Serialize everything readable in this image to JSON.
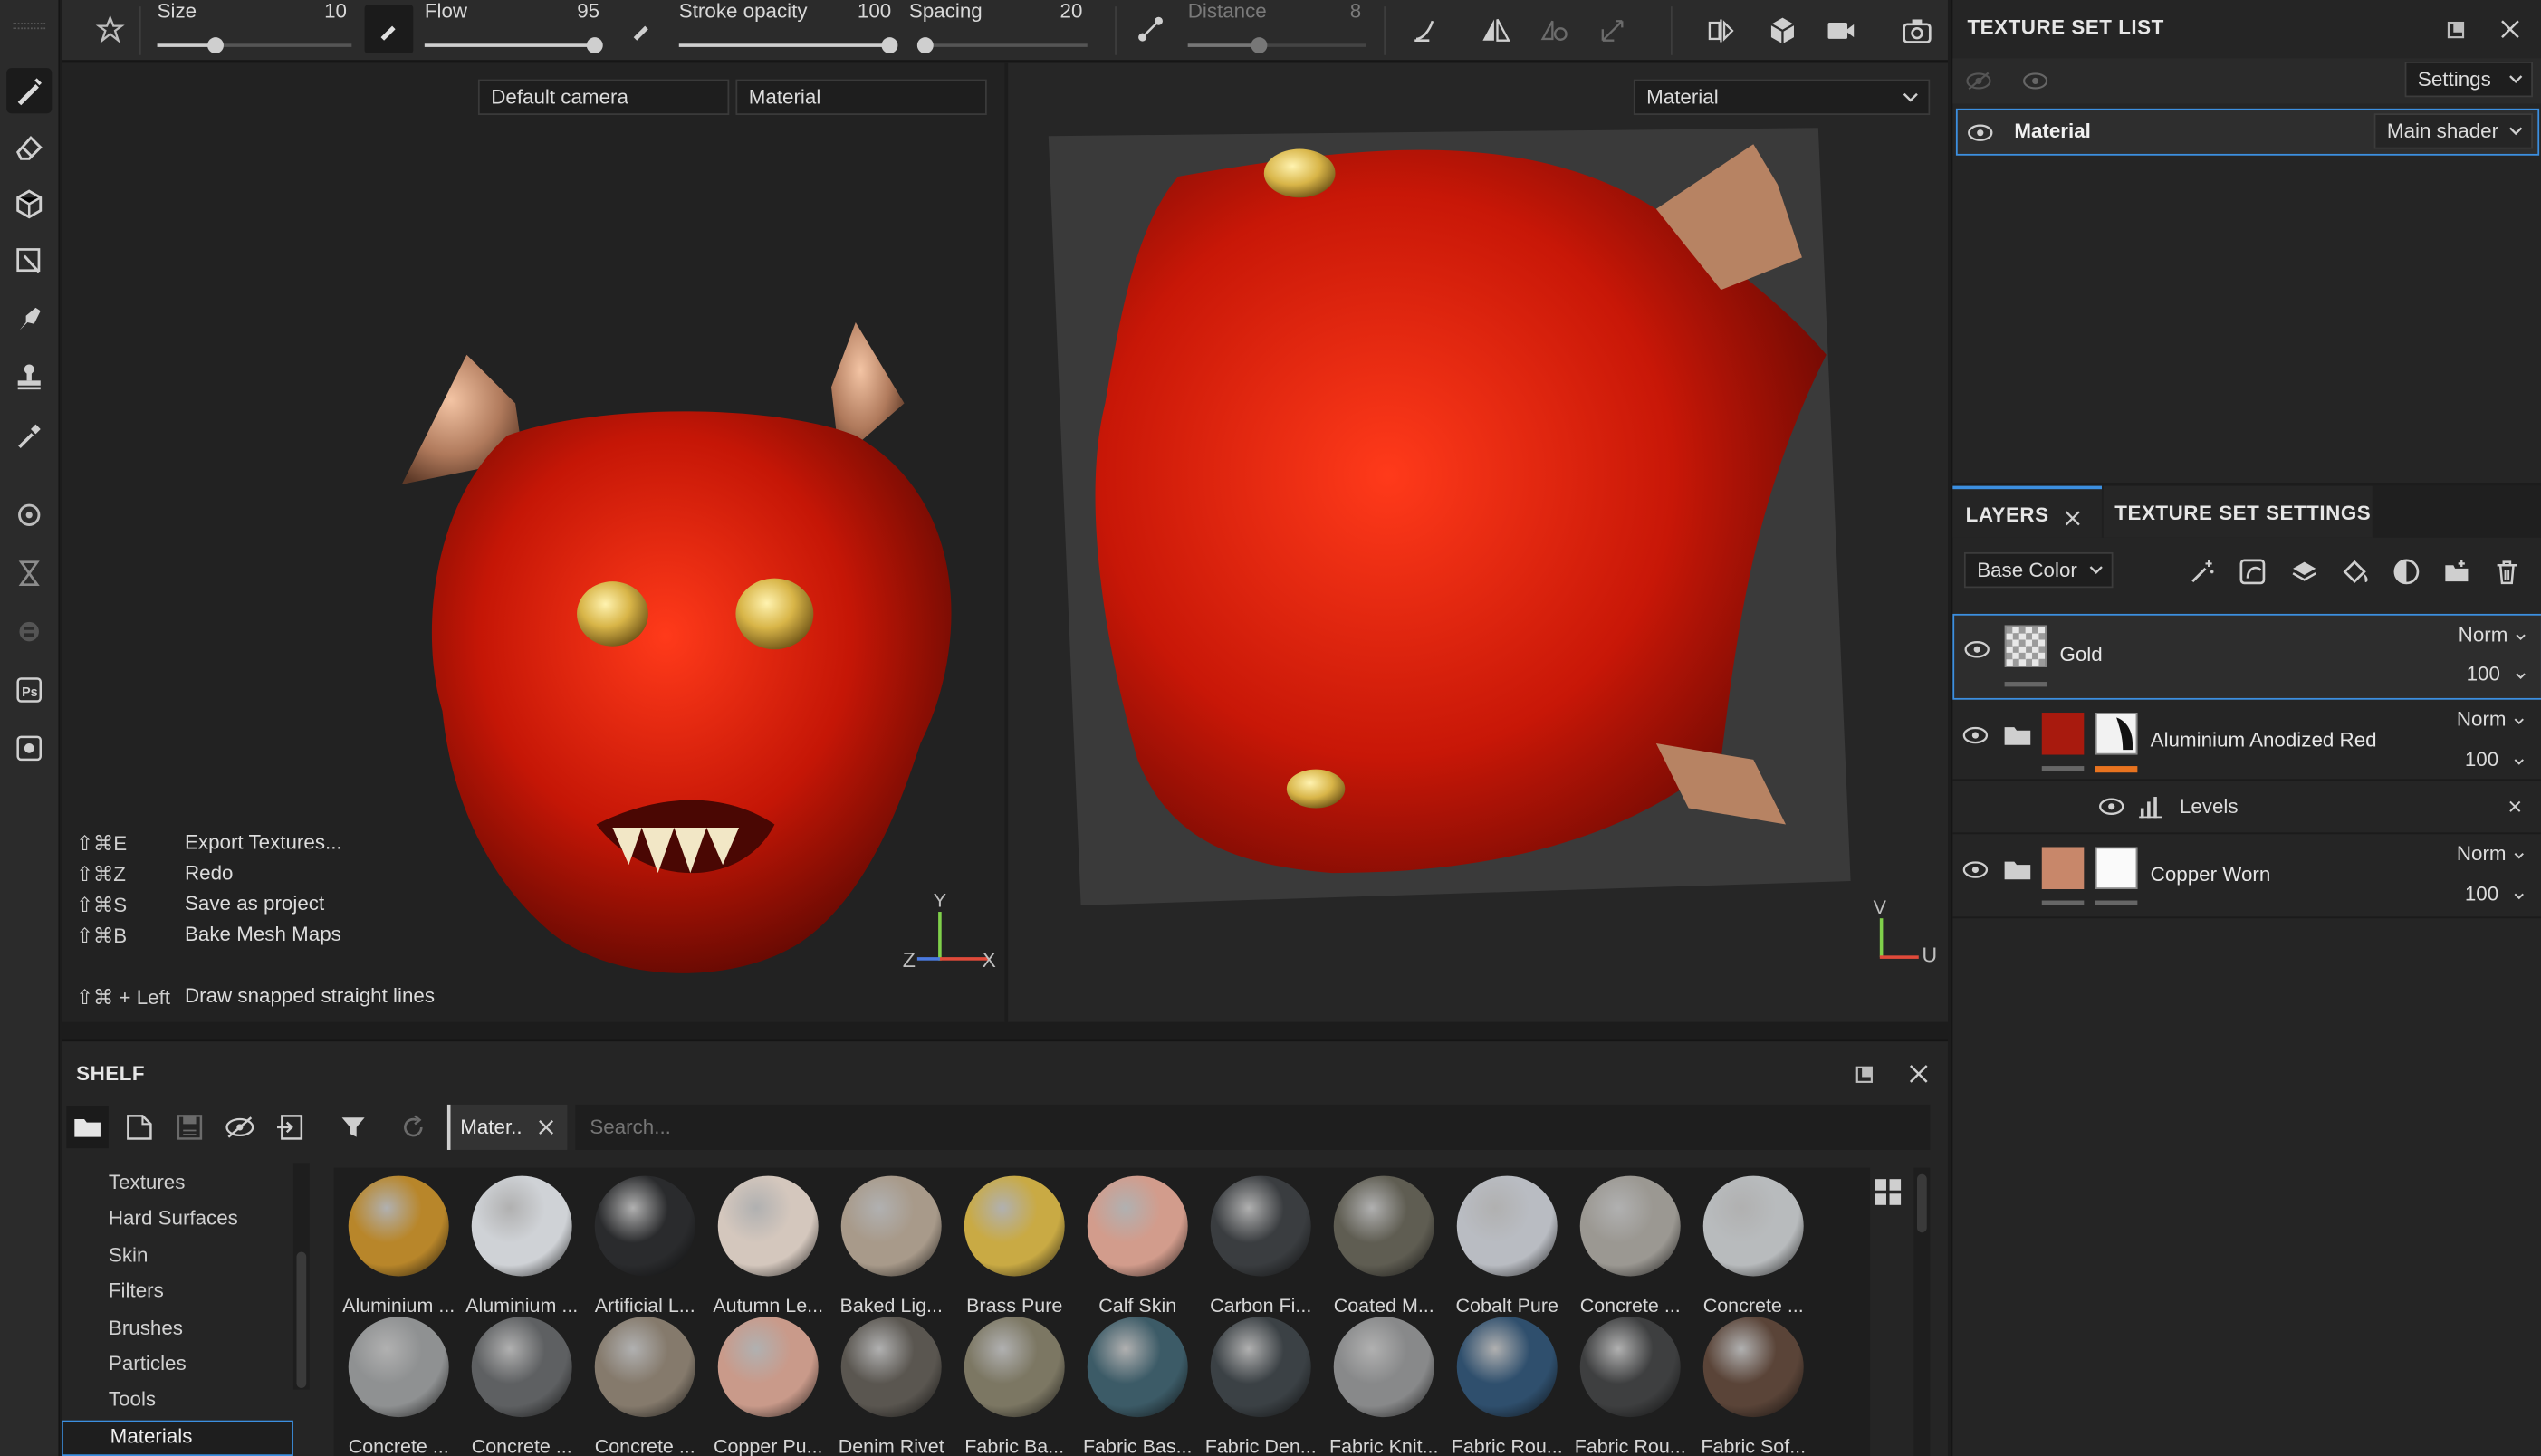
{
  "toolbar": {
    "size": {
      "label": "Size",
      "value": "10",
      "fraction": 0.3
    },
    "flow": {
      "label": "Flow",
      "value": "95",
      "fraction": 0.95
    },
    "stroke_opacity": {
      "label": "Stroke opacity",
      "value": "100",
      "fraction": 1.0
    },
    "spacing": {
      "label": "Spacing",
      "value": "20",
      "fraction": 0.0
    },
    "distance": {
      "label": "Distance",
      "value": "8",
      "fraction": 0.4
    }
  },
  "viewport3d": {
    "camera": "Default camera",
    "channel": "Material",
    "shortcuts": [
      {
        "key": "⇧⌘E",
        "label": "Export Textures..."
      },
      {
        "key": "⇧⌘Z",
        "label": "Redo"
      },
      {
        "key": "⇧⌘S",
        "label": "Save as project"
      },
      {
        "key": "⇧⌘B",
        "label": "Bake Mesh Maps"
      }
    ],
    "hint_key": "⇧⌘ + Left",
    "hint_label": "Draw snapped straight lines",
    "axes": {
      "y": "Y",
      "z": "Z",
      "x": "X"
    }
  },
  "viewport2d": {
    "channel": "Material",
    "axes": {
      "v": "V",
      "u": "U"
    }
  },
  "texture_set_list": {
    "title": "TEXTURE SET LIST",
    "settings_label": "Settings",
    "item_name": "Material",
    "shader": "Main shader"
  },
  "layers_panel": {
    "tab_layers": "LAYERS",
    "tab_settings": "TEXTURE SET SETTINGS",
    "channel": "Base Color",
    "layers": [
      {
        "name": "Gold",
        "blend": "Norm",
        "opacity": "100"
      },
      {
        "name": "Aluminium Anodized Red",
        "blend": "Norm",
        "opacity": "100",
        "color": "#a81a0e"
      },
      {
        "name": "Copper Worn",
        "blend": "Norm",
        "opacity": "100",
        "color": "#c8876a"
      }
    ],
    "effect_name": "Levels"
  },
  "shelf": {
    "title": "SHELF",
    "filter_tag": "Mater..",
    "search_placeholder": "Search...",
    "categories": [
      "Textures",
      "Hard Surfaces",
      "Skin",
      "Filters",
      "Brushes",
      "Particles",
      "Tools",
      "Materials"
    ],
    "selected_category": "Materials",
    "materials": [
      {
        "name": "Aluminium ...",
        "color": "#b8862a"
      },
      {
        "name": "Aluminium ...",
        "color": "#cfd2d6"
      },
      {
        "name": "Artificial L...",
        "color": "#2a2b2d"
      },
      {
        "name": "Autumn Le...",
        "color": "#d4c7bd"
      },
      {
        "name": "Baked Lig...",
        "color": "#a89a8a"
      },
      {
        "name": "Brass Pure",
        "color": "#c9aa44"
      },
      {
        "name": "Calf Skin",
        "color": "#d29c8c"
      },
      {
        "name": "Carbon Fi...",
        "color": "#3a3d40"
      },
      {
        "name": "Coated M...",
        "color": "#5f5d52"
      },
      {
        "name": "Cobalt Pure",
        "color": "#b9bcc2"
      },
      {
        "name": "Concrete ...",
        "color": "#9b9892"
      },
      {
        "name": "Concrete ...",
        "color": "#b8bbbd"
      },
      {
        "name": "Concrete ...",
        "color": "#8f9192"
      },
      {
        "name": "Concrete ...",
        "color": "#5e6062"
      },
      {
        "name": "Concrete ...",
        "color": "#857a6c"
      },
      {
        "name": "Copper Pu...",
        "color": "#c99a8a"
      },
      {
        "name": "Denim Rivet",
        "color": "#5a5650"
      },
      {
        "name": "Fabric Ba...",
        "color": "#7c7763"
      },
      {
        "name": "Fabric Bas...",
        "color": "#3c5b67"
      },
      {
        "name": "Fabric Den...",
        "color": "#3b4145"
      },
      {
        "name": "Fabric Knit...",
        "color": "#88898a"
      },
      {
        "name": "Fabric Rou...",
        "color": "#2f4f6d"
      },
      {
        "name": "Fabric Rou...",
        "color": "#3e3f40"
      },
      {
        "name": "Fabric Sof...",
        "color": "#5a4438"
      }
    ]
  }
}
